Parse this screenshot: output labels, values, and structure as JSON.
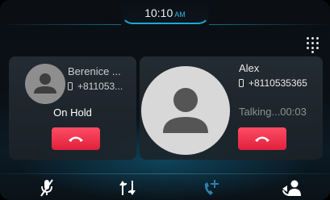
{
  "status_bar": {
    "time": "10:10",
    "ampm": "AM"
  },
  "held_call": {
    "name": "Berenice ...",
    "number": "+811053...",
    "status": "On Hold",
    "avatar_icon": "person-icon",
    "end_icon": "hang-up-icon"
  },
  "active_call": {
    "name": "Alex",
    "number": "+8110535365",
    "status": "Talking...00:03",
    "avatar_icon": "person-icon",
    "end_icon": "hang-up-icon"
  },
  "toolbar": {
    "keypad_icon": "dialpad-icon",
    "buttons": [
      {
        "icon": "mute-microphone-icon",
        "enabled": true
      },
      {
        "icon": "merge-calls-icon",
        "enabled": true
      },
      {
        "icon": "add-call-icon",
        "enabled": false
      },
      {
        "icon": "transfer-call-icon",
        "enabled": true
      }
    ]
  },
  "colors": {
    "accent": "#33b6e6",
    "end_call": "#f23a52",
    "disabled": "#2f7fa8"
  }
}
